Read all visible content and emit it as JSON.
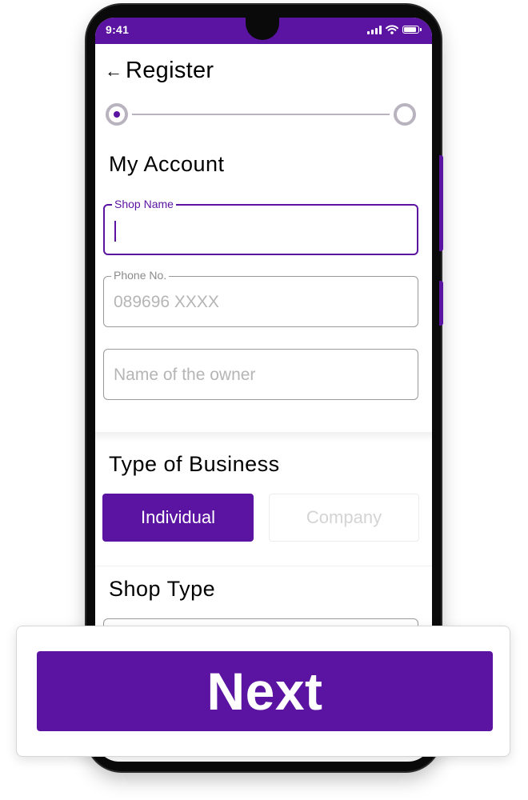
{
  "colors": {
    "accent": "#5b13a1",
    "placeholder": "#b5b5b5",
    "stepper_inactive": "#b9b3bf"
  },
  "status_bar": {
    "time": "9:41"
  },
  "header": {
    "back_icon": "arrow-left-icon",
    "title": "Register"
  },
  "stepper": {
    "current_step": 1,
    "total_steps": 2
  },
  "account_section": {
    "title": "My Account",
    "fields": [
      {
        "label": "Shop Name",
        "value": "",
        "placeholder": "",
        "active": true
      },
      {
        "label": "Phone No.",
        "value": "",
        "placeholder": "089696 XXXX",
        "active": false
      },
      {
        "label": "",
        "value": "",
        "placeholder": "Name of the owner",
        "active": false
      }
    ]
  },
  "business_section": {
    "title": "Type of Business",
    "options": [
      {
        "label": "Individual",
        "selected": true
      },
      {
        "label": "Company",
        "selected": false
      }
    ]
  },
  "shop_type_section": {
    "title": "Shop Type"
  },
  "footer": {
    "next_label": "Next"
  }
}
